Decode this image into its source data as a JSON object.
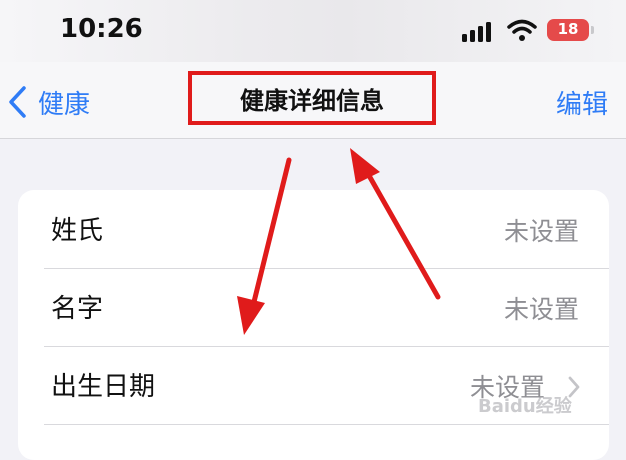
{
  "status_bar": {
    "time": "10:26",
    "battery": "18",
    "battery_color": "#e54a4a",
    "icons": [
      "signal-icon",
      "wifi-icon",
      "battery-icon"
    ]
  },
  "nav": {
    "back_label": "健康",
    "title": "健康详细信息",
    "edit_label": "编辑",
    "accent_color": "#2f7cf6",
    "highlight_color": "#e01b1b"
  },
  "rows": [
    {
      "label": "姓氏",
      "value": "未设置"
    },
    {
      "label": "名字",
      "value": "未设置"
    },
    {
      "label": "出生日期",
      "value": "未设置"
    }
  ],
  "watermark": "Baidu经验"
}
